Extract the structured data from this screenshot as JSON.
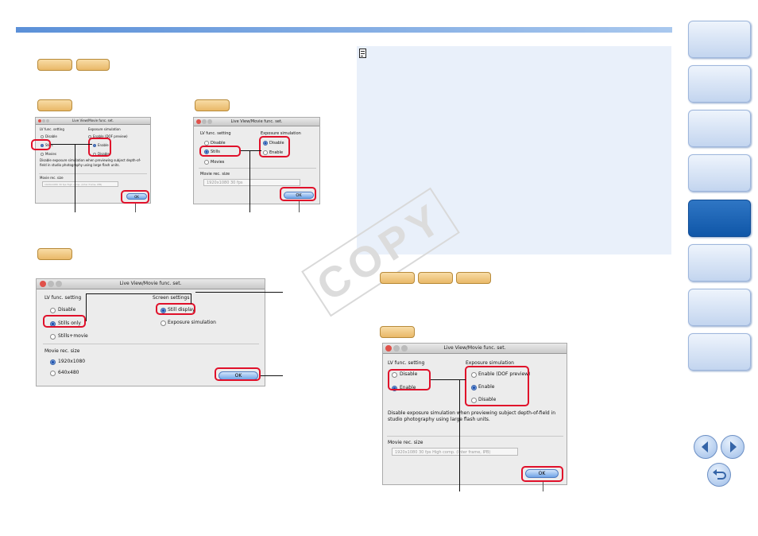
{
  "page": {
    "accent": "#5b90d8",
    "watermark": "COPY",
    "note_icon": "memo-icon",
    "section_tabs": [
      {
        "name": "tab-1",
        "active": false
      },
      {
        "name": "tab-2",
        "active": false
      },
      {
        "name": "tab-3",
        "active": false
      },
      {
        "name": "tab-4",
        "active": false
      },
      {
        "name": "tab-5",
        "active": true
      },
      {
        "name": "tab-6",
        "active": false
      },
      {
        "name": "tab-7",
        "active": false
      },
      {
        "name": "tab-8",
        "active": false
      }
    ],
    "nav_icons": [
      "prev-page-icon",
      "next-page-icon",
      "back-icon"
    ]
  },
  "dialog": {
    "title": "Live View/Movie func. set.",
    "lv_func_setting": "LV func. setting",
    "exposure_simulation": "Exposure simulation",
    "screen_settings": "Screen settings",
    "disable": "Disable",
    "stills": "Stills",
    "movies": "Movies",
    "stills_only": "Stills only",
    "stills_movie": "Stills+movie",
    "enable": "Enable",
    "enable_dof": "Enable (DOF preview)",
    "still_display": "Still display",
    "exposure_simulation_option": "Exposure simulation",
    "movie_rec_size": "Movie rec. size",
    "size_1920": "1920x1080",
    "size_640": "640x480",
    "select_1920_30": "1920x1080 30 fps",
    "select_high_comp": "1920x1080 30 fps High comp. (Inter frame, IPB)",
    "description": "Disable exposure simulation when previewing subject depth-of-field in studio photography using large flash units.",
    "ok": "OK"
  }
}
